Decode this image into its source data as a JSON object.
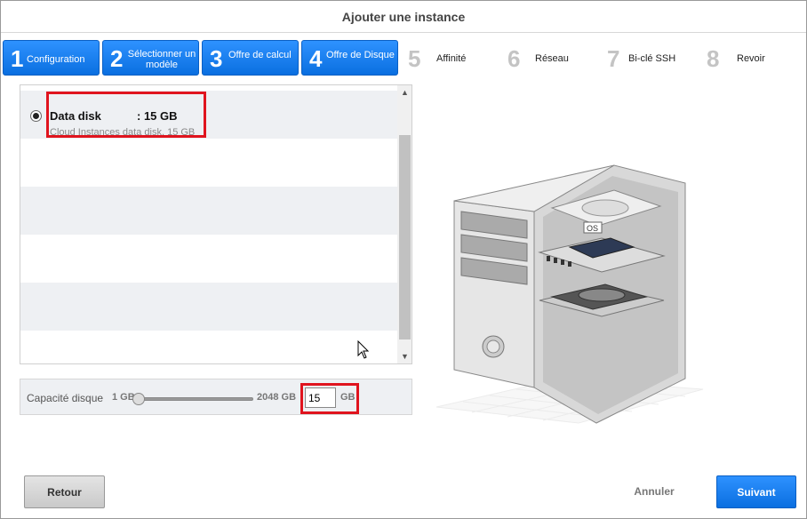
{
  "dialog": {
    "title": "Ajouter une instance"
  },
  "steps": [
    {
      "num": "1",
      "label": "Configuration",
      "state": "active"
    },
    {
      "num": "2",
      "label": "Sélectionner un modèle",
      "state": "active"
    },
    {
      "num": "3",
      "label": "Offre de calcul",
      "state": "active"
    },
    {
      "num": "4",
      "label": "Offre de Disque",
      "state": "active"
    },
    {
      "num": "5",
      "label": "Affinité",
      "state": "inactive"
    },
    {
      "num": "6",
      "label": "Réseau",
      "state": "inactive"
    },
    {
      "num": "7",
      "label": "Bi-clé SSH",
      "state": "inactive"
    },
    {
      "num": "8",
      "label": "Revoir",
      "state": "inactive"
    }
  ],
  "disk_offers": [
    {
      "name": "Data disk",
      "size": ": 15 GB",
      "description": "Cloud Instances data disk, 15 GB",
      "selected": true
    }
  ],
  "capacity": {
    "label": "Capacité disque",
    "min": "1 GB",
    "max": "2048 GB",
    "value": "15",
    "unit": "GB"
  },
  "footer": {
    "back_label": "Retour",
    "cancel_label": "Annuler",
    "next_label": "Suivant"
  },
  "colors": {
    "accent": "#0a7cf0",
    "highlight": "#e0141e"
  }
}
